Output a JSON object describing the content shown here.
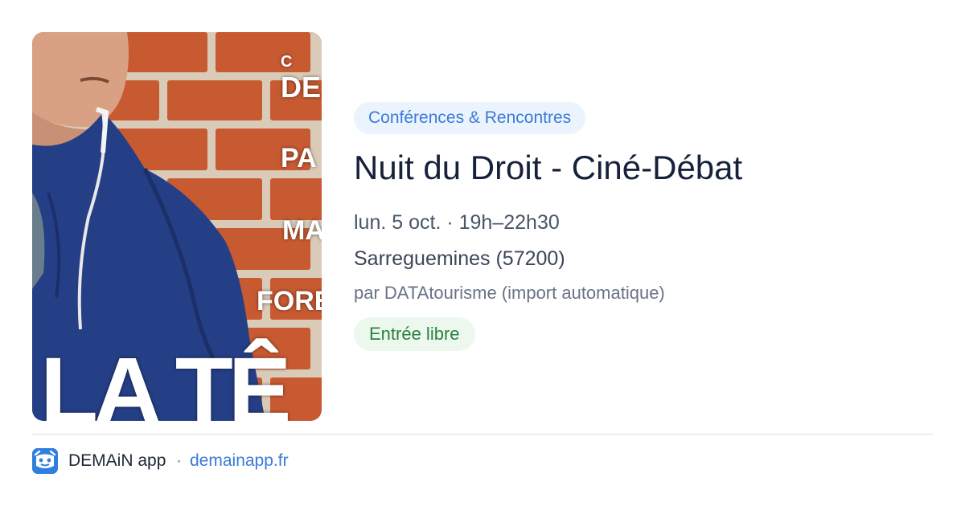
{
  "poster": {
    "alt": "Affiche du film projeté",
    "lines": [
      "C",
      "DE",
      "PA",
      "MA",
      "FORE",
      "LA TÊ"
    ]
  },
  "event": {
    "category": "Conférences & Rencontres",
    "title": "Nuit du Droit - Ciné-Débat",
    "datetime": "lun. 5 oct. · 19h–22h30",
    "place": "Sarreguemines (57200)",
    "organizer": "par DATAtourisme (import automatique)",
    "price": "Entrée libre"
  },
  "footer": {
    "app_name": "DEMAiN app",
    "separator": "·",
    "link": "demainapp.fr"
  },
  "colors": {
    "accent": "#3a7ad9",
    "category_bg": "#ebf3fd",
    "price_text": "#2b8040",
    "price_bg": "#ecf8ee",
    "app_icon": "#2f7fe0"
  },
  "icons": {
    "app": "demain-logo-icon"
  }
}
